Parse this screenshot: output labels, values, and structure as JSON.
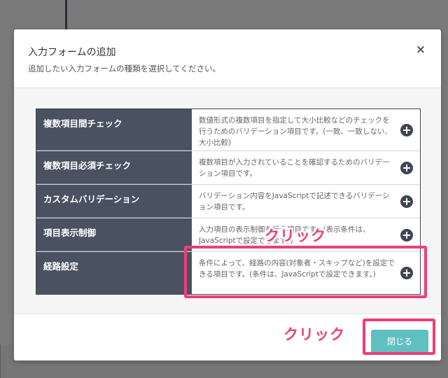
{
  "modal": {
    "title": "入力フォームの追加",
    "subtitle": "追加したい入力フォームの種類を選択してください。",
    "close_icon": "×",
    "options": [
      {
        "name": "複数項目間チェック",
        "description": "数値形式の複数項目を指定して大小比較などのチェックを行うためのバリデーション項目です。(一致、一致しない、大小比較)"
      },
      {
        "name": "複数項目必須チェック",
        "description": "複数項目が入力されていることを確認するためのバリデーション項目です。"
      },
      {
        "name": "カスタムバリデーション",
        "description": "バリデーション内容をJavaScriptで記述できるバリデーション項目です。"
      },
      {
        "name": "項目表示制御",
        "description": "入力項目の表示制御を行う項目です。(表示条件は、JavaScriptで設定できます。)"
      },
      {
        "name": "経路設定",
        "description": "条件によって、経路の内容(対象者・スキップなど)を設定できる項目です。(条件は、JavaScriptで設定できます。)"
      }
    ],
    "close_button_label": "閉じる"
  },
  "annotations": {
    "click_row": "クリック",
    "click_button": "クリック"
  },
  "colors": {
    "accent_teal": "#5fc0c0",
    "option_header_bg": "#4a5261",
    "highlight_pink": "#ee3f7a"
  }
}
